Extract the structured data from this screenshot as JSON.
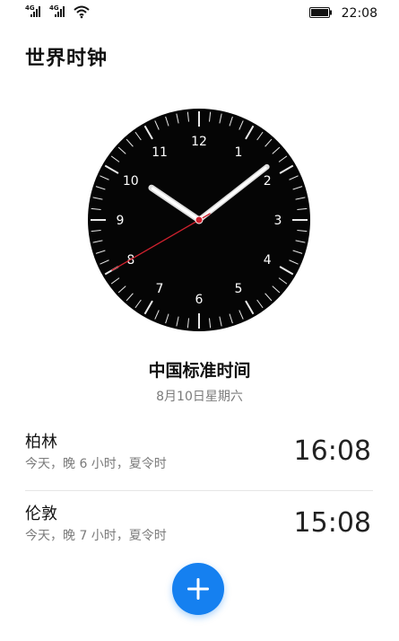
{
  "status_bar": {
    "sim1_tag": "4G",
    "sim2_tag": "4G",
    "time": "22:08",
    "icons": [
      "signal-icon",
      "signal-icon",
      "wifi-icon",
      "battery-icon"
    ]
  },
  "header": {
    "title": "世界时钟"
  },
  "clock": {
    "hours": [
      "12",
      "1",
      "2",
      "3",
      "4",
      "5",
      "6",
      "7",
      "8",
      "9",
      "10",
      "11"
    ],
    "hour_hand_time": "10:08",
    "second_hand_seconds": 40,
    "accent_color": "#d0212e"
  },
  "local_zone": {
    "name": "中国标准时间",
    "date": "8月10日星期六"
  },
  "cities": [
    {
      "name": "柏林",
      "desc": "今天，晚 6 小时，夏令时",
      "time": "16:08"
    },
    {
      "name": "伦敦",
      "desc": "今天，晚 7 小时，夏令时",
      "time": "15:08"
    }
  ],
  "fab": {
    "icon": "plus-icon",
    "color": "#1580f0"
  }
}
